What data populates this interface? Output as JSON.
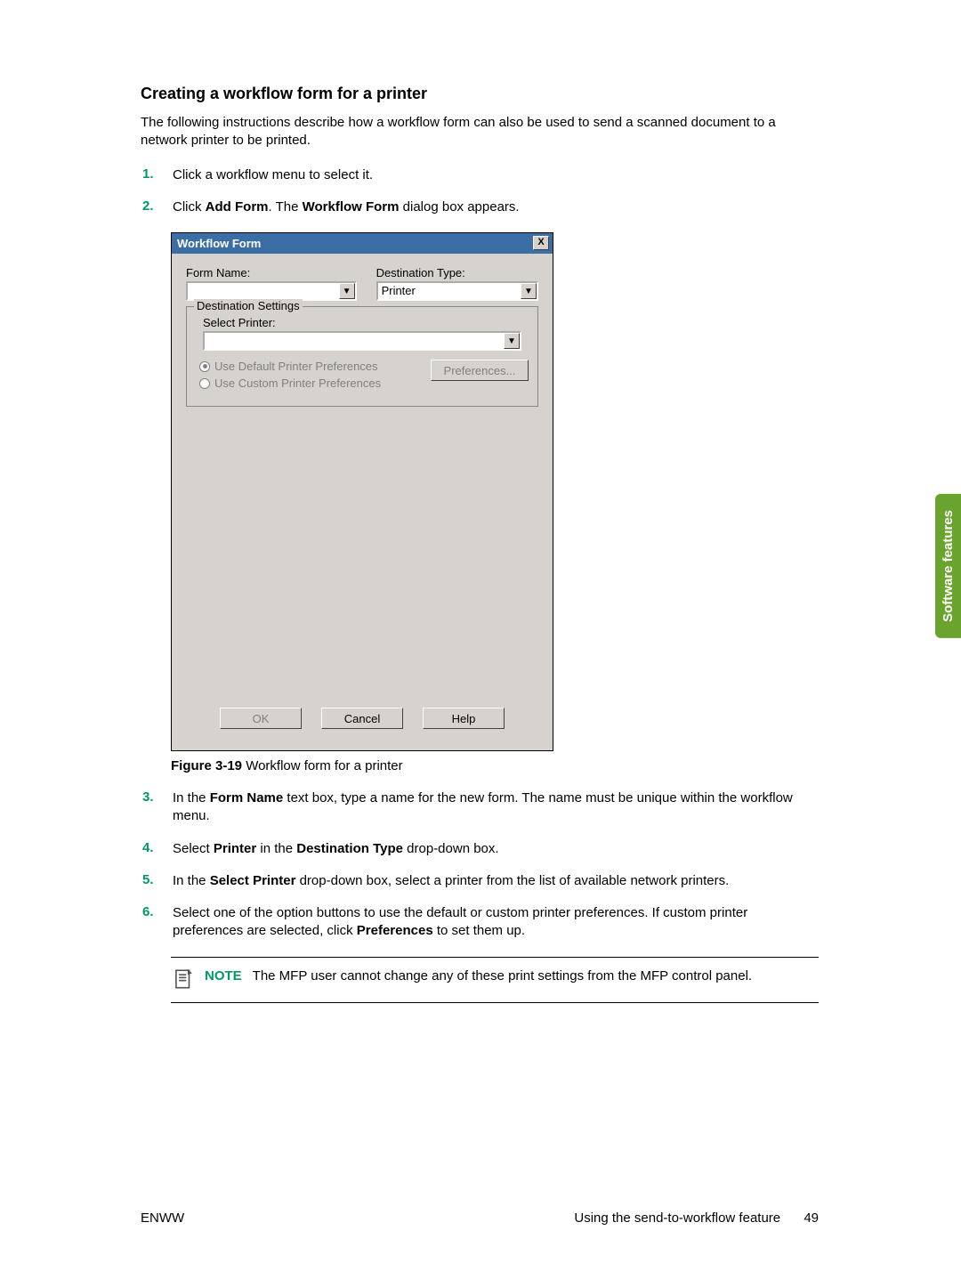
{
  "section_title": "Creating a workflow form for a printer",
  "intro": "The following instructions describe how a workflow form can also be used to send a scanned document to a network printer to be printed.",
  "steps": [
    {
      "num": "1.",
      "html": "Click a workflow menu to select it."
    },
    {
      "num": "2.",
      "html": "Click <b>Add Form</b>. The <b>Workflow Form</b> dialog box appears."
    },
    {
      "num": "3.",
      "html": "In the <b>Form Name</b> text box, type a name for the new form. The name must be unique within the workflow menu."
    },
    {
      "num": "4.",
      "html": "Select <b>Printer</b> in the <b>Destination Type</b> drop-down box."
    },
    {
      "num": "5.",
      "html": "In the <b>Select Printer</b> drop-down box, select a printer from the list of available network printers."
    },
    {
      "num": "6.",
      "html": "Select one of the option buttons to use the default or custom printer preferences. If custom printer preferences are selected, click <b>Preferences</b> to set them up."
    }
  ],
  "dialog": {
    "title": "Workflow Form",
    "close": "X",
    "form_name_label": "Form Name:",
    "form_name_value": "",
    "dest_type_label": "Destination Type:",
    "dest_type_value": "Printer",
    "group_legend": "Destination Settings",
    "select_printer_label": "Select Printer:",
    "select_printer_value": "",
    "radio_default": "Use Default Printer Preferences",
    "radio_custom": "Use Custom Printer Preferences",
    "preferences_btn": "Preferences...",
    "ok": "OK",
    "cancel": "Cancel",
    "help": "Help",
    "chevron": "▼"
  },
  "figure": {
    "label": "Figure 3-19",
    "caption": "  Workflow form for a printer"
  },
  "note": {
    "label": "NOTE",
    "text": "The MFP user cannot change any of these print settings from the MFP control panel."
  },
  "side_tab": "Software features",
  "footer": {
    "left": "ENWW",
    "right": "Using the send-to-workflow feature",
    "page": "49"
  }
}
